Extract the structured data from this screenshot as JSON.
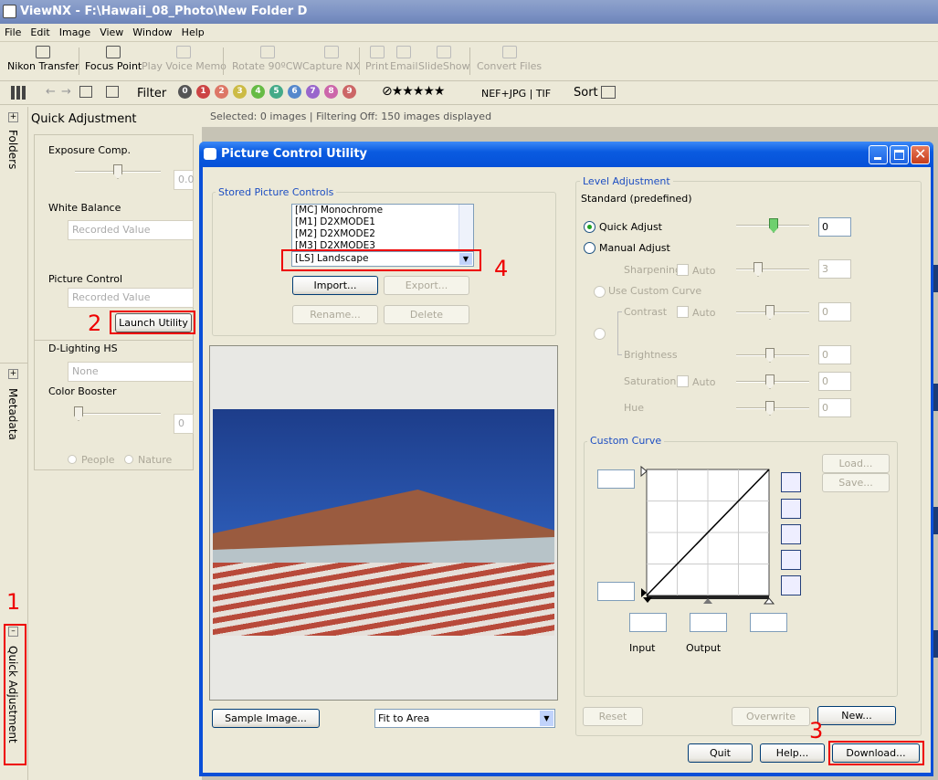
{
  "app": {
    "title": "ViewNX - F:\\Hawaii_08_Photo\\New Folder D"
  },
  "menu": [
    "File",
    "Edit",
    "Image",
    "View",
    "Window",
    "Help"
  ],
  "toolbar": {
    "nikon_transfer": "Nikon Transfer",
    "focus_point": "Focus Point",
    "play_voice_memo": "Play Voice Memo",
    "rotate": "Rotate 90ºCW",
    "capture_nx": "Capture NX",
    "print": "Print",
    "email": "Email",
    "slideshow": "SlideShow",
    "convert_files": "Convert Files"
  },
  "filterbar": {
    "filter_label": "Filter",
    "ratings": [
      "0",
      "1",
      "2",
      "3",
      "4",
      "5",
      "6",
      "7",
      "8",
      "9"
    ],
    "format": "NEF+JPG | TIF",
    "sort": "Sort"
  },
  "sidebar": {
    "folders": "Folders",
    "metadata": "Metadata",
    "quick_adjustment": "Quick Adjustment"
  },
  "quick_adjustment": {
    "title": "Quick Adjustment",
    "exposure_comp": "Exposure Comp.",
    "exposure_value": "0.0",
    "white_balance": "White Balance",
    "white_balance_value": "Recorded Value",
    "picture_control": "Picture Control",
    "picture_control_value": "Recorded Value",
    "launch_utility": "Launch Utility",
    "d_lighting": "D-Lighting HS",
    "d_lighting_value": "None",
    "color_booster": "Color Booster",
    "color_booster_value": "0",
    "people": "People",
    "nature": "Nature"
  },
  "status": "Selected: 0 images | Filtering Off: 150 images displayed",
  "dialog": {
    "title": "Picture Control Utility",
    "stored_title": "Stored Picture Controls",
    "list": [
      "[MC] Monochrome",
      "[M1] D2XMODE1",
      "[M2] D2XMODE2",
      "[M3] D2XMODE3"
    ],
    "selected": "[LS] Landscape",
    "import": "Import...",
    "export": "Export...",
    "rename": "Rename...",
    "delete": "Delete",
    "sample_image": "Sample Image...",
    "fit": "Fit to Area",
    "level_title": "Level Adjustment",
    "level_subtitle": "Standard (predefined)",
    "quick_adjust": "Quick Adjust",
    "quick_adjust_value": "0",
    "manual_adjust": "Manual Adjust",
    "sharpening": "Sharpening",
    "sharpening_value": "3",
    "auto": "Auto",
    "use_custom_curve": "Use Custom Curve",
    "contrast": "Contrast",
    "contrast_value": "0",
    "brightness": "Brightness",
    "brightness_value": "0",
    "saturation": "Saturation",
    "saturation_value": "0",
    "hue": "Hue",
    "hue_value": "0",
    "curve_title": "Custom Curve",
    "load": "Load...",
    "save": "Save...",
    "input": "Input",
    "output": "Output",
    "reset": "Reset",
    "overwrite": "Overwrite",
    "new": "New...",
    "quit": "Quit",
    "help": "Help...",
    "download": "Download..."
  },
  "annotations": {
    "n1": "1",
    "n2": "2",
    "n3": "3",
    "n4": "4"
  },
  "colors": {
    "accent": "#0a5be0",
    "annotation": "#e00000"
  }
}
